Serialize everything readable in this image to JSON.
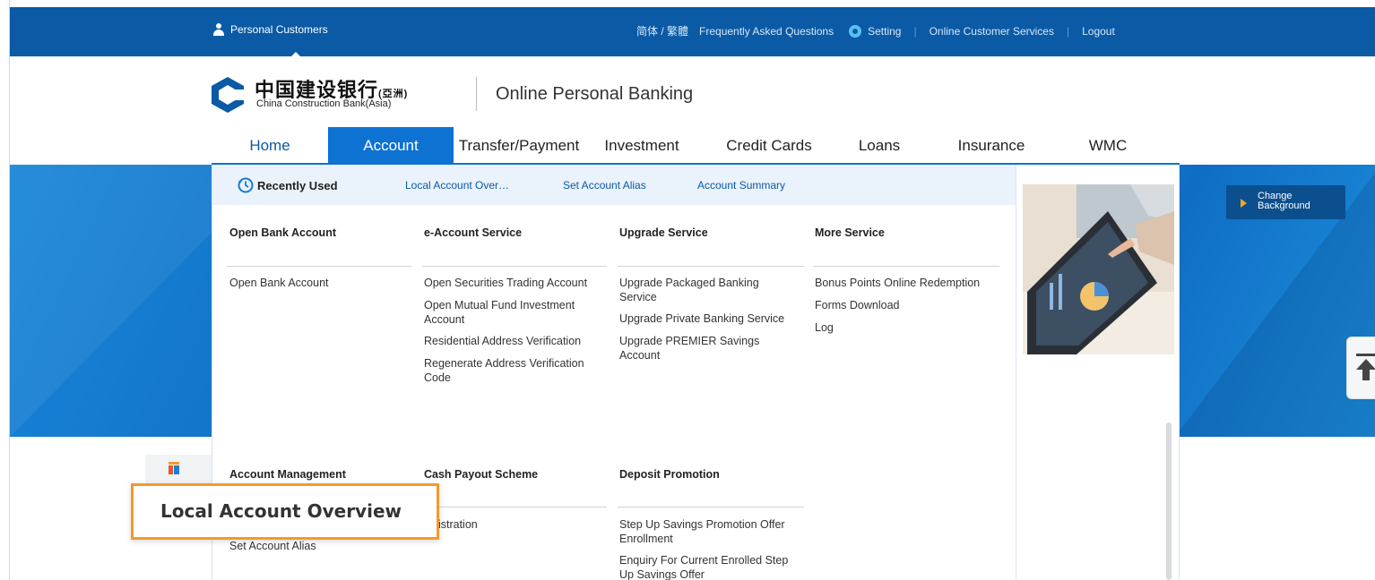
{
  "topbar": {
    "personal_customers": "Personal Customers",
    "lang": "简体 / 繁體",
    "faq": "Frequently Asked Questions",
    "setting": "Setting",
    "online_services": "Online Customer Services",
    "logout": "Logout",
    "separator": "|"
  },
  "header": {
    "logo_cn": "中国建设银行",
    "logo_cn_suffix": "(亞洲)",
    "logo_en": "China Construction Bank(Asia)",
    "product_title": "Online Personal Banking"
  },
  "nav": {
    "items": [
      "Home",
      "Account",
      "Transfer/Payment",
      "Investment",
      "Credit Cards",
      "Loans",
      "Insurance",
      "WMC"
    ],
    "active": "Account"
  },
  "recently_used": {
    "label": "Recently Used",
    "links": [
      "Local Account Over…",
      "Set Account Alias",
      "Account Summary"
    ]
  },
  "menu": {
    "open_bank_account": {
      "title": "Open Bank Account",
      "items": [
        "Open Bank Account"
      ]
    },
    "e_account_service": {
      "title": "e-Account Service",
      "items": [
        "Open Securities Trading Account",
        "Open Mutual Fund Investment Account",
        "Residential Address Verification",
        "Regenerate Address Verification Code"
      ]
    },
    "upgrade_service": {
      "title": "Upgrade Service",
      "items": [
        "Upgrade Packaged Banking Service",
        "Upgrade Private Banking Service",
        "Upgrade PREMIER Savings Account"
      ]
    },
    "more_service": {
      "title": "More Service",
      "items": [
        "Bonus Points Online Redemption",
        "Forms Download",
        "Log"
      ]
    },
    "account_management": {
      "title": "Account Management",
      "items": [
        "Set Account Alias"
      ]
    },
    "cash_payout_scheme": {
      "title": "Cash Payout Scheme",
      "items": [
        "gistration"
      ]
    },
    "deposit_promotion": {
      "title": "Deposit Promotion",
      "items": [
        "Step Up Savings Promotion Offer Enrollment",
        "Enquiry For Current Enrolled Step Up Savings Offer"
      ]
    }
  },
  "change_background": "Change Background",
  "tooltip": "Local Account Overview",
  "colors": {
    "brand_blue": "#0a5aa6",
    "active_tab": "#0d72d2",
    "callout_border": "#f39a2b"
  }
}
